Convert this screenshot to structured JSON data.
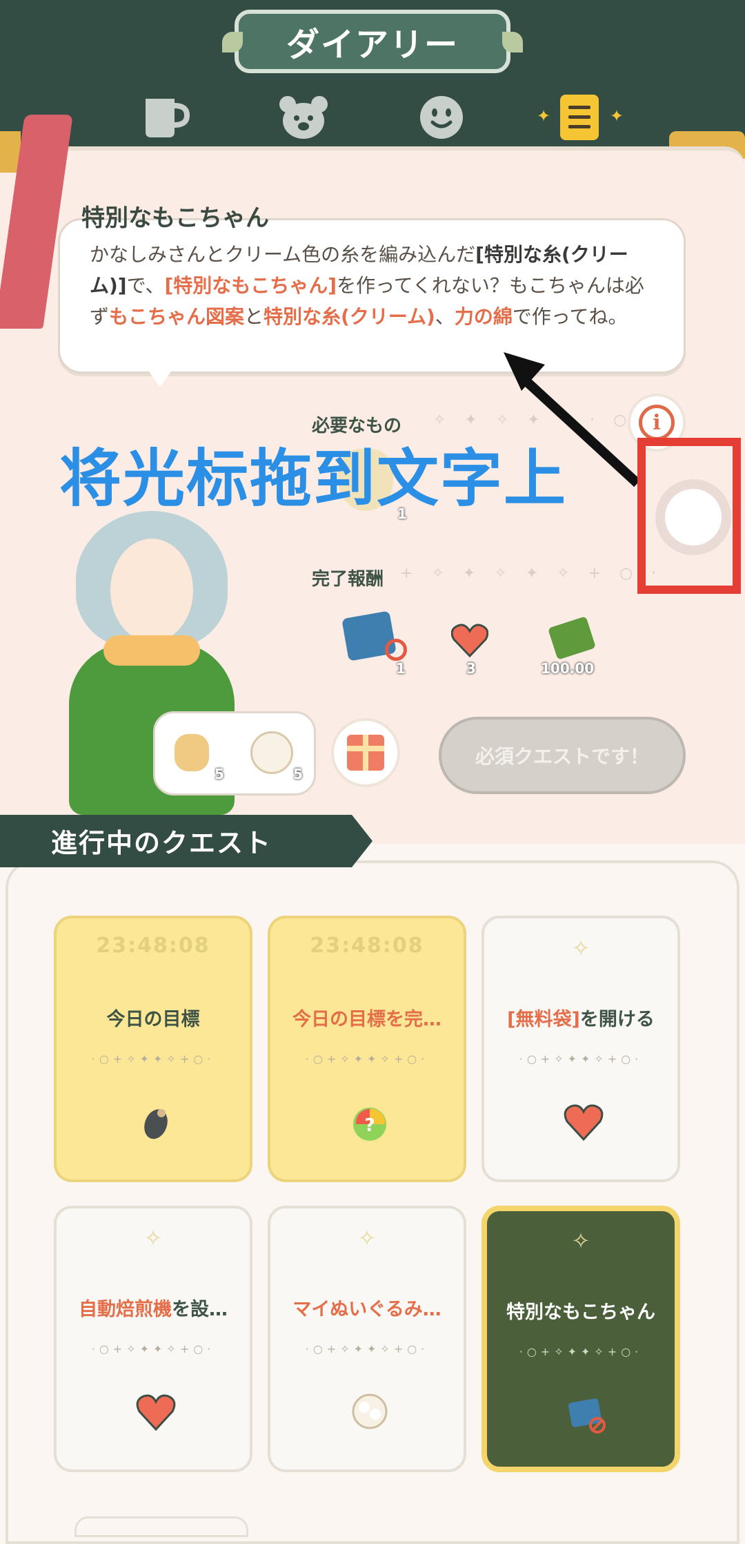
{
  "header": {
    "title": "ダイアリー",
    "tabs": [
      {
        "name": "cup"
      },
      {
        "name": "bear"
      },
      {
        "name": "face"
      },
      {
        "name": "diary",
        "active": true
      }
    ]
  },
  "quest_detail": {
    "title": "特別なもこちゃん",
    "body": [
      {
        "t": "かなしみさんとクリーム色の糸を編み込んだ",
        "s": "n"
      },
      {
        "t": "[特別な糸(クリーム)]",
        "s": "dark"
      },
      {
        "t": "で、",
        "s": "n"
      },
      {
        "t": "[特別なもこちゃん]",
        "s": "red"
      },
      {
        "t": "を作ってくれない？もこちゃんは必ず",
        "s": "n"
      },
      {
        "t": "もこちゃん図案",
        "s": "red"
      },
      {
        "t": "と",
        "s": "n"
      },
      {
        "t": "特別な糸(クリーム)",
        "s": "red"
      },
      {
        "t": "、",
        "s": "n"
      },
      {
        "t": "力の綿",
        "s": "red"
      },
      {
        "t": "で作ってね。",
        "s": "n"
      }
    ],
    "required_label": "必要なもの",
    "required_count": "1",
    "reward_label": "完了報酬",
    "rewards": [
      {
        "icon": "pattern-icon",
        "count": "1"
      },
      {
        "icon": "heart-icon",
        "count": "3"
      },
      {
        "icon": "money-icon",
        "count": "100.00"
      }
    ],
    "gift_items": [
      {
        "icon": "croissant-icon",
        "count": "5"
      },
      {
        "icon": "cotton-icon",
        "count": "5"
      }
    ],
    "required_button": "必須クエストです！"
  },
  "annotation": {
    "text": "将光标拖到文字上",
    "color": "#2b8fe5",
    "frame_color": "#e53e35"
  },
  "quests": {
    "banner": "進行中のクエスト",
    "cards": [
      {
        "timer": "23:48:08",
        "label": [
          {
            "t": "今日の目標",
            "s": "n"
          }
        ],
        "style": "yellow",
        "icon": "mole-icon"
      },
      {
        "timer": "23:48:08",
        "label": [
          {
            "t": "今日の目標を完…",
            "s": "red"
          }
        ],
        "style": "yellow",
        "icon": "mystery-bag-icon"
      },
      {
        "timer": "",
        "label": [
          {
            "t": "[無料袋]",
            "s": "red"
          },
          {
            "t": "を開ける",
            "s": "n"
          }
        ],
        "style": "white",
        "icon": "heart-icon"
      },
      {
        "timer": "",
        "label": [
          {
            "t": "自動焙煎機",
            "s": "red"
          },
          {
            "t": "を設…",
            "s": "n"
          }
        ],
        "style": "white",
        "icon": "heart-icon"
      },
      {
        "timer": "",
        "label": [
          {
            "t": "マイぬいぐるみ…",
            "s": "red"
          }
        ],
        "style": "white",
        "icon": "cotton-icon"
      },
      {
        "timer": "",
        "label": [
          {
            "t": "特別なもこちゃん",
            "s": "n"
          }
        ],
        "style": "dark",
        "icon": "pattern-icon"
      }
    ]
  },
  "colors": {
    "header_bg": "#344d44",
    "accent_red": "#e56e4a",
    "accent_yellow": "#f5c534"
  }
}
